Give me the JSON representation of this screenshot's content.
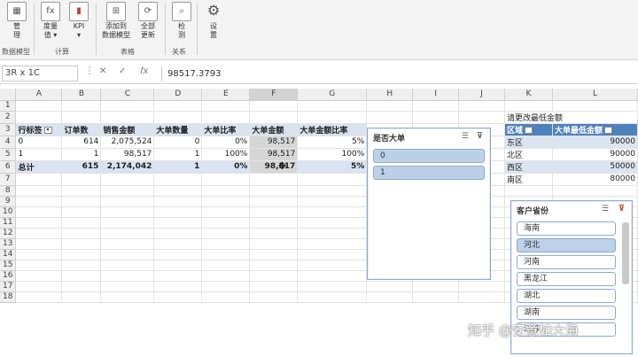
{
  "ribbon": {
    "buttons": [
      {
        "name": "manage-button",
        "label": "管\n理",
        "icon": "▦"
      },
      {
        "name": "measure-button",
        "label": "度量\n值 ▾",
        "icon": "fx"
      },
      {
        "name": "kpi-button",
        "label": "KPI\n▾",
        "icon": "▮"
      },
      {
        "name": "add-to-model-button",
        "label": "添加到\n数据模型",
        "icon": "⊞"
      },
      {
        "name": "refresh-all-button",
        "label": "全部\n更新",
        "icon": "⟳"
      },
      {
        "name": "detect-button",
        "label": "检\n测",
        "icon": "⌕"
      },
      {
        "name": "settings-button",
        "label": "设\n置",
        "icon": "⚙"
      }
    ],
    "groups": [
      "数据模型",
      "计算",
      "表格",
      "关系"
    ]
  },
  "formula_bar": {
    "name_box": "3R x 1C",
    "cancel_icon": "✕",
    "enter_icon": "✓",
    "fx_icon": "fx",
    "formula": "98517.3793"
  },
  "grid": {
    "columns": [
      "A",
      "B",
      "C",
      "D",
      "E",
      "F",
      "G",
      "H",
      "I",
      "J",
      "K",
      "L"
    ],
    "rows": [
      "1",
      "2",
      "3",
      "4",
      "5",
      "6",
      "7",
      "8",
      "9",
      "10",
      "11",
      "12",
      "13",
      "14",
      "15",
      "16",
      "17",
      "18"
    ]
  },
  "pivot": {
    "headers": [
      "行标签",
      "订单数",
      "销售金额",
      "大单数量",
      "大单比率",
      "大单金额",
      "大单金额比率"
    ],
    "rows": [
      [
        "0",
        "614",
        "2,075,524",
        "0",
        "0%",
        "98,517",
        "5%"
      ],
      [
        "1",
        "1",
        "98,517",
        "1",
        "100%",
        "98,517",
        "100%"
      ]
    ],
    "total": [
      "总计",
      "615",
      "2,174,042",
      "1",
      "0%",
      "98,517",
      "5%"
    ]
  },
  "threshold_table": {
    "title": "请更改最低金额",
    "headers": [
      "区域",
      "大单最低金额"
    ],
    "rows": [
      [
        "东区",
        "90000"
      ],
      [
        "北区",
        "90000"
      ],
      [
        "西区",
        "50000"
      ],
      [
        "南区",
        "80000"
      ]
    ]
  },
  "slicer_big_order": {
    "title": "是否大单",
    "items": [
      "0",
      "1"
    ]
  },
  "slicer_province": {
    "title": "客户省份",
    "items": [
      "海南",
      "河北",
      "河南",
      "黑龙江",
      "湖北",
      "湖南",
      "江苏"
    ],
    "selected": "河北"
  },
  "watermark": "知乎 @安意如大海"
}
